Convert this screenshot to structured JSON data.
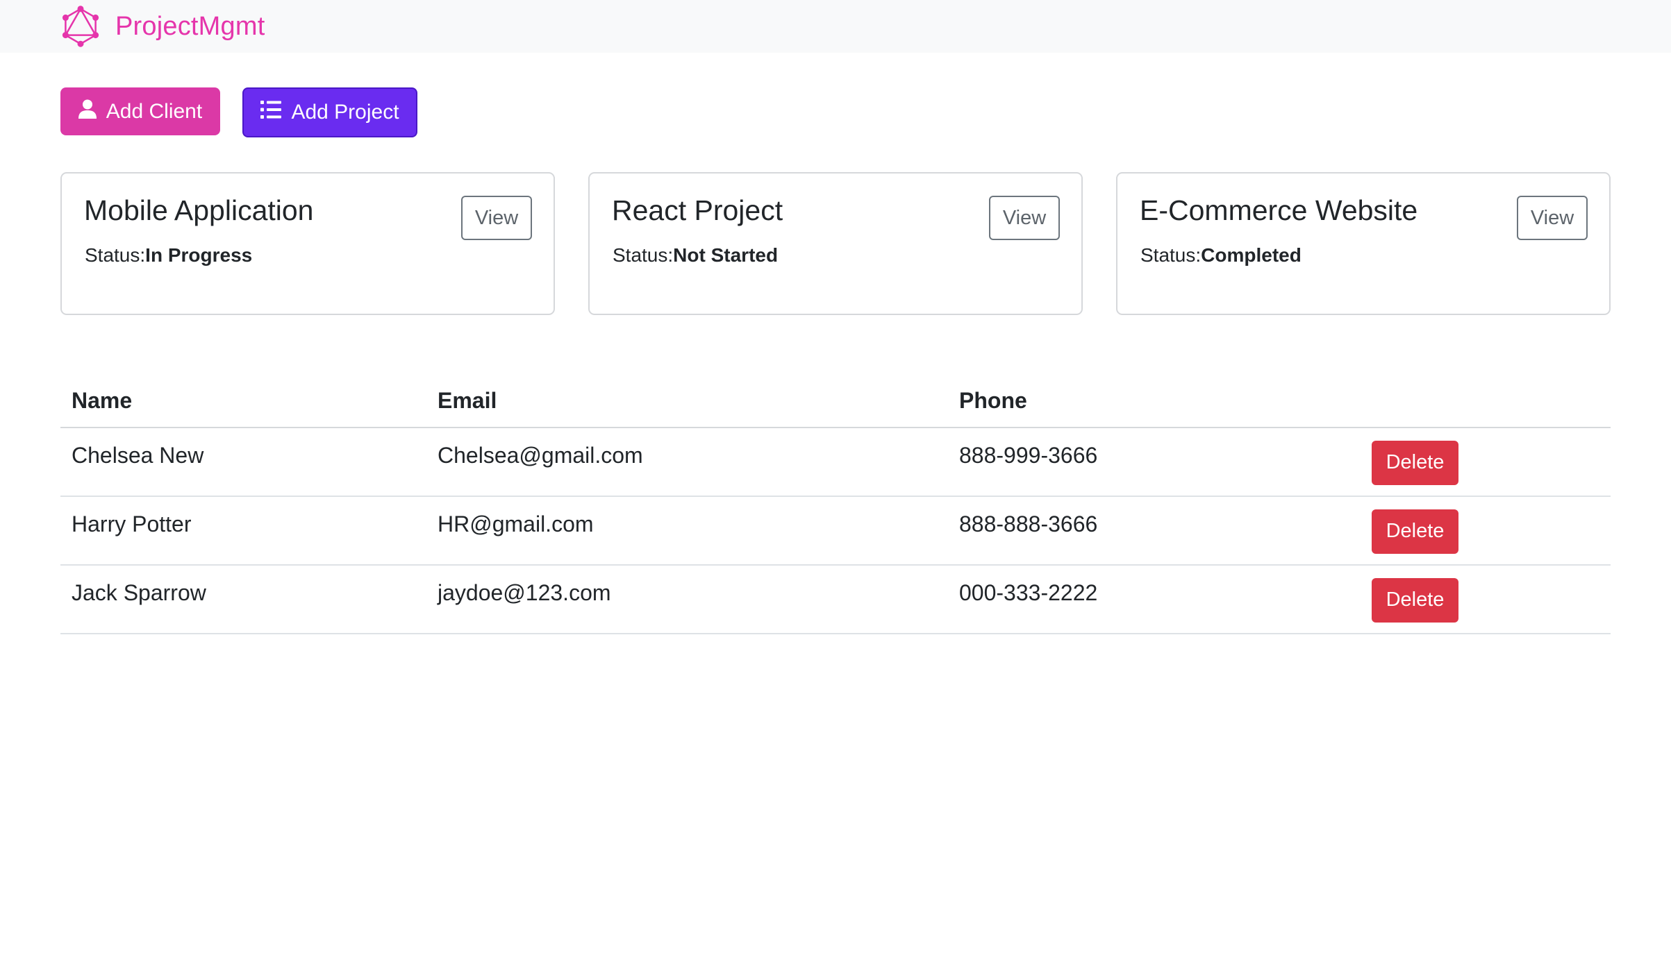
{
  "brand": {
    "name": "ProjectMgmt",
    "logo_icon": "graphql-logo-icon",
    "color": "#e535ab"
  },
  "actions": {
    "add_client": {
      "label": "Add Client",
      "icon": "user-icon",
      "color": "#db39a6"
    },
    "add_project": {
      "label": "Add Project",
      "icon": "list-icon",
      "color": "#6a2cf0"
    }
  },
  "projects": [
    {
      "title": "Mobile Application",
      "status_label": "Status:",
      "status": "In Progress",
      "view_label": "View"
    },
    {
      "title": "React Project",
      "status_label": "Status:",
      "status": "Not Started",
      "view_label": "View"
    },
    {
      "title": "E-Commerce Website",
      "status_label": "Status:",
      "status": "Completed",
      "view_label": "View"
    }
  ],
  "clients_table": {
    "columns": [
      "Name",
      "Email",
      "Phone",
      ""
    ],
    "rows": [
      {
        "name": "Chelsea New",
        "email": "Chelsea@gmail.com",
        "phone": "888-999-3666",
        "action": "Delete"
      },
      {
        "name": "Harry Potter",
        "email": "HR@gmail.com",
        "phone": "888-888-3666",
        "action": "Delete"
      },
      {
        "name": "Jack Sparrow",
        "email": "jaydoe@123.com",
        "phone": "000-333-2222",
        "action": "Delete"
      }
    ]
  },
  "colors": {
    "delete": "#dc3545",
    "navbar_bg": "#f8f9fa"
  }
}
